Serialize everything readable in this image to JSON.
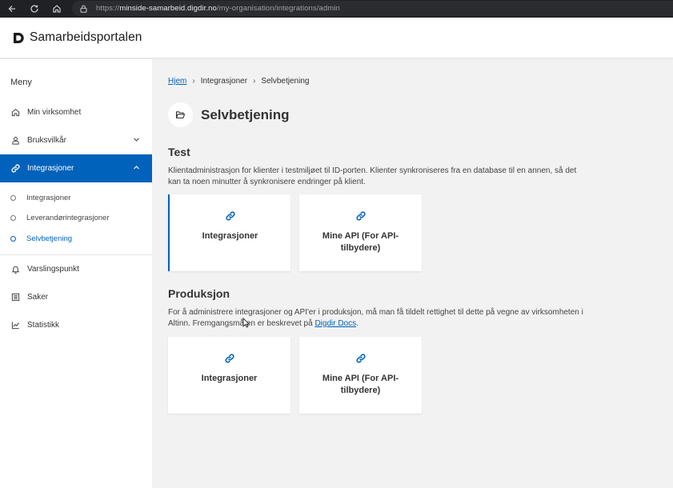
{
  "browser": {
    "url_prefix": "https://",
    "url_host": "minside-samarbeid.digdir.no",
    "url_path": "/my-organisation/integrations/admin",
    "icons": [
      "back-arrow-icon",
      "reload-icon",
      "home-icon",
      "lock-icon"
    ]
  },
  "header": {
    "brand": "Samarbeidsportalen",
    "logo_icon": "digdir-logo-icon"
  },
  "sidebar": {
    "menu_title": "Meny",
    "items": [
      {
        "label": "Min virksomhet",
        "icon": "home-icon"
      },
      {
        "label": "Bruksvilkår",
        "icon": "user-icon",
        "chevron": "chevron-down-icon"
      },
      {
        "label": "Integrasjoner",
        "icon": "link-icon",
        "chevron": "chevron-up-icon",
        "active": true
      },
      {
        "label": "Varslingspunkt",
        "icon": "bell-icon"
      },
      {
        "label": "Saker",
        "icon": "list-icon"
      },
      {
        "label": "Statistikk",
        "icon": "chart-icon"
      }
    ],
    "subitems": [
      {
        "label": "Integrasjoner"
      },
      {
        "label": "Leverandørintegrasjoner"
      },
      {
        "label": "Selvbetjening",
        "selected": true
      }
    ],
    "active_color": "#0062ba"
  },
  "breadcrumb": {
    "home": "Hjem",
    "level1": "Integrasjoner",
    "current": "Selvbetjening",
    "separator": "›"
  },
  "page": {
    "title": "Selvbetjening",
    "title_icon": "folder-open-icon"
  },
  "test": {
    "heading": "Test",
    "description": "Klientadministrasjon for klienter i testmiljøet til ID-porten. Klienter synkroniseres fra en database til en annen, så det kan ta noen minutter å synkronisere endringer på klient.",
    "cards": [
      {
        "label": "Integrasjoner",
        "icon": "link-icon"
      },
      {
        "label": "Mine API (For API-tilbydere)",
        "icon": "link-icon"
      }
    ]
  },
  "production": {
    "heading": "Produksjon",
    "description_before": "For å administrere integrasjoner og API'er i produksjon, må man få tildelt rettighet til dette på vegne av virksomheten i Altinn. Fremgangsmåten er beskrevet på ",
    "link": "Digdir Docs",
    "description_after": ".",
    "cards": [
      {
        "label": "Integrasjoner",
        "icon": "link-icon"
      },
      {
        "label": "Mine API (For API-tilbydere)",
        "icon": "link-icon"
      }
    ]
  }
}
